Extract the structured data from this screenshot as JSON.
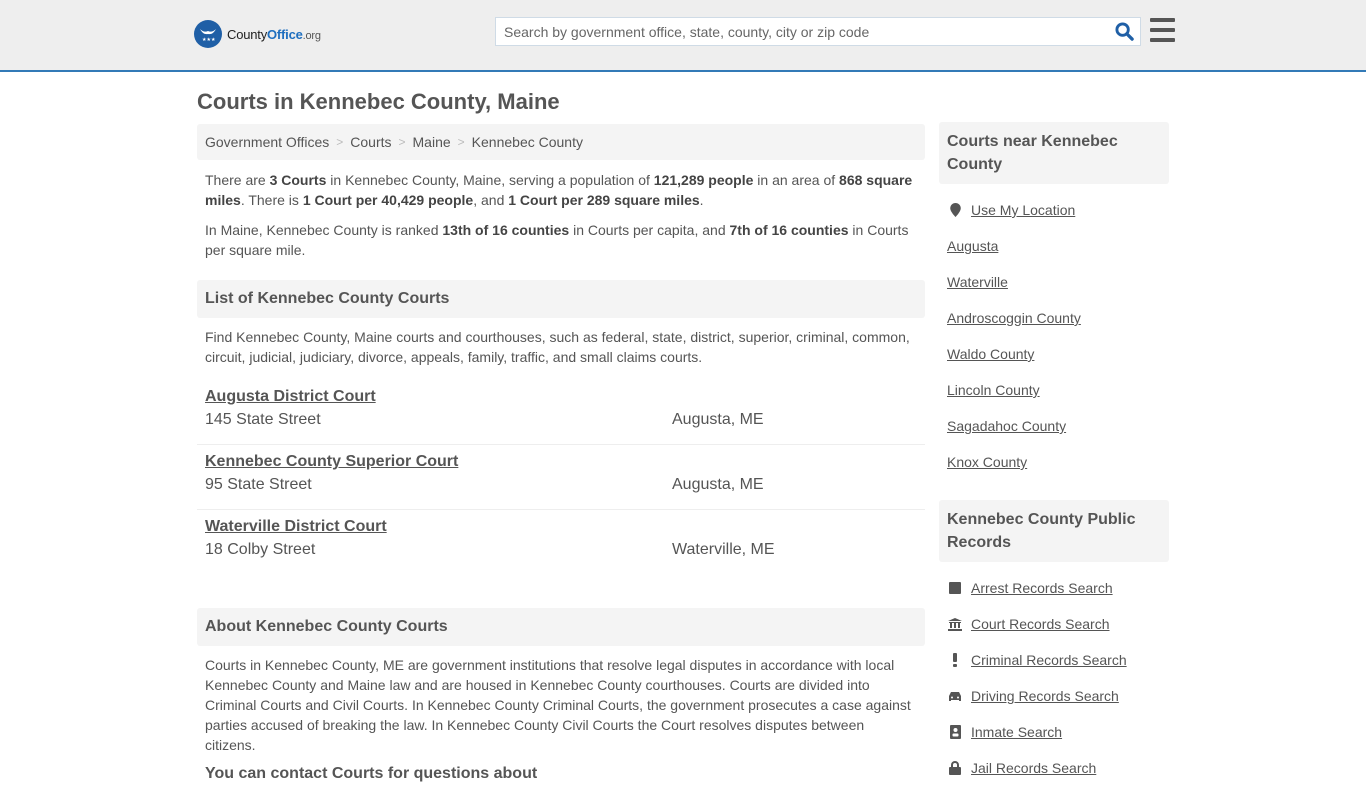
{
  "header": {
    "logo_county": "County",
    "logo_office": "Office",
    "logo_org": ".org",
    "search_placeholder": "Search by government office, state, county, city or zip code",
    "search_value": "",
    "search_icon": "search-icon",
    "menu_icon": "hamburger-menu-icon",
    "accent_color": "#337ab7"
  },
  "page": {
    "title": "Courts in Kennebec County, Maine",
    "breadcrumb": [
      "Government Offices",
      "Courts",
      "Maine",
      "Kennebec County"
    ],
    "summary": {
      "p1": [
        "There are ",
        "3 Courts",
        " in Kennebec County, Maine, serving a population of ",
        "121,289 people",
        " in an area of ",
        "868 square miles",
        ". There is ",
        "1 Court per 40,429 people",
        ", and ",
        "1 Court per 289 square miles",
        "."
      ],
      "p2": [
        "In Maine, Kennebec County is ranked ",
        "13th of 16 counties",
        " in Courts per capita, and ",
        "7th of 16 counties",
        " in Courts per square mile."
      ]
    },
    "list_heading": "List of Kennebec County Courts",
    "list_intro": "Find Kennebec County, Maine courts and courthouses, such as federal, state, district, superior, criminal, common, circuit, judicial, judiciary, divorce, appeals, family, traffic, and small claims courts.",
    "courts": [
      {
        "name": "Augusta District Court",
        "address": "145 State Street",
        "city": "Augusta, ME"
      },
      {
        "name": "Kennebec County Superior Court",
        "address": "95 State Street",
        "city": "Augusta, ME"
      },
      {
        "name": "Waterville District Court",
        "address": "18 Colby Street",
        "city": "Waterville, ME"
      }
    ],
    "about_heading": "About Kennebec County Courts",
    "about_text": "Courts in Kennebec County, ME are government institutions that resolve legal disputes in accordance with local Kennebec County and Maine law and are housed in Kennebec County courthouses. Courts are divided into Criminal Courts and Civil Courts. In Kennebec County Criminal Courts, the government prosecutes a case against parties accused of breaking the law. In Kennebec County Civil Courts the Court resolves disputes between citizens.",
    "next_heading": "You can contact Courts for questions about"
  },
  "sidebar": {
    "nearby_heading": "Courts near Kennebec County",
    "use_location": "Use My Location",
    "nearby": [
      "Augusta",
      "Waterville",
      "Androscoggin County",
      "Waldo County",
      "Lincoln County",
      "Sagadahoc County",
      "Knox County"
    ],
    "records_heading": "Kennebec County Public Records",
    "records": [
      {
        "label": "Arrest Records Search",
        "icon": "square-icon"
      },
      {
        "label": "Court Records Search",
        "icon": "courthouse-icon"
      },
      {
        "label": "Criminal Records Search",
        "icon": "exclamation-icon"
      },
      {
        "label": "Driving Records Search",
        "icon": "car-icon"
      },
      {
        "label": "Inmate Search",
        "icon": "id-badge-icon"
      },
      {
        "label": "Jail Records Search",
        "icon": "lock-icon"
      }
    ]
  }
}
